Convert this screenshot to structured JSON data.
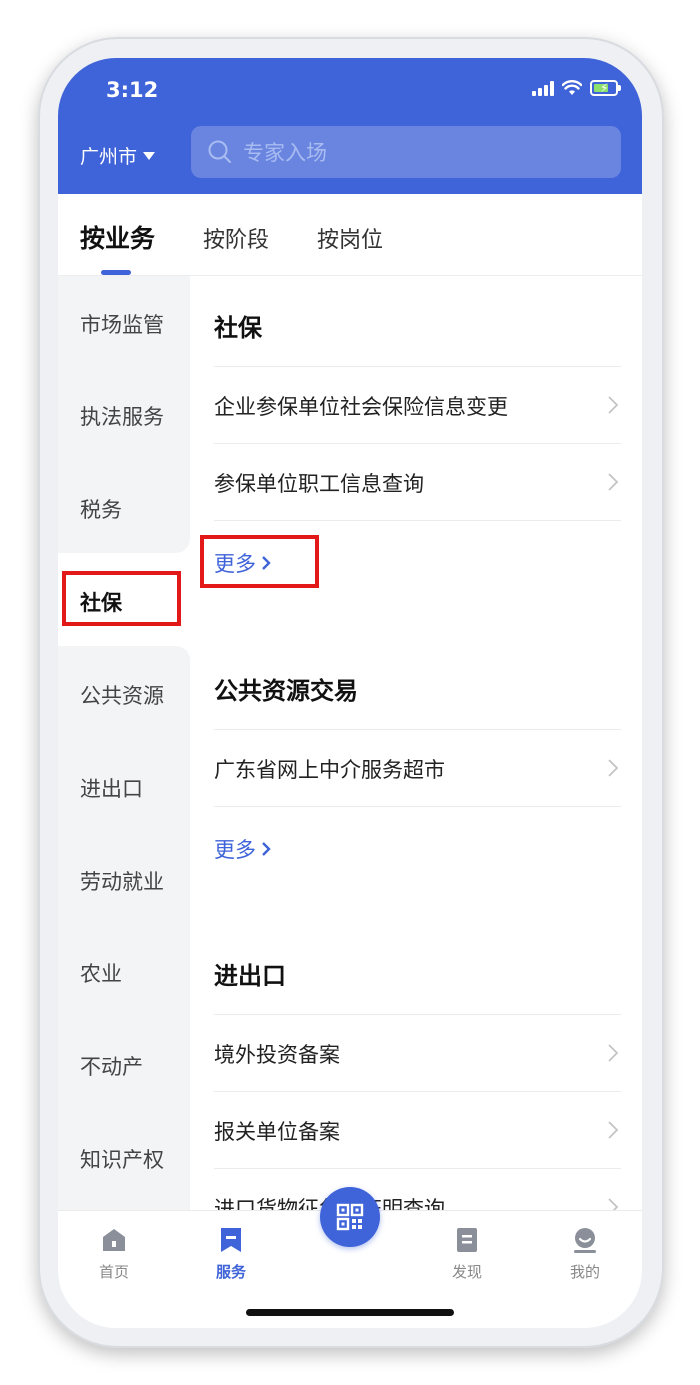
{
  "status_bar": {
    "time": "3:12"
  },
  "header": {
    "city": "广州市",
    "search_placeholder": "专家入场"
  },
  "tabs": [
    {
      "label": "按业务",
      "active": true
    },
    {
      "label": "按阶段",
      "active": false
    },
    {
      "label": "按岗位",
      "active": false
    }
  ],
  "sidebar": {
    "items": [
      "市场监管",
      "执法服务",
      "税务",
      "社保",
      "公共资源",
      "进出口",
      "劳动就业",
      "农业",
      "不动产",
      "知识产权"
    ],
    "active": "社保"
  },
  "sections": [
    {
      "title": "社保",
      "items": [
        "企业参保单位社会保险信息变更",
        "参保单位职工信息查询"
      ],
      "more": "更多"
    },
    {
      "title": "公共资源交易",
      "items": [
        "广东省网上中介服务超市"
      ],
      "more": "更多"
    },
    {
      "title": "进出口",
      "items": [
        "境外投资备案",
        "报关单位备案",
        "进口货物征免税证明查询"
      ]
    }
  ],
  "tabbar": {
    "items": [
      {
        "label": "首页",
        "icon": "home-icon"
      },
      {
        "label": "服务",
        "icon": "bookmark-icon",
        "active": true
      },
      {
        "label": "",
        "icon": "qr-code-icon"
      },
      {
        "label": "发现",
        "icon": "document-icon"
      },
      {
        "label": "我的",
        "icon": "profile-icon"
      }
    ]
  },
  "colors": {
    "primary": "#3f63d8",
    "highlight": "#e31919",
    "sidebar_bg": "#f3f4f6"
  }
}
